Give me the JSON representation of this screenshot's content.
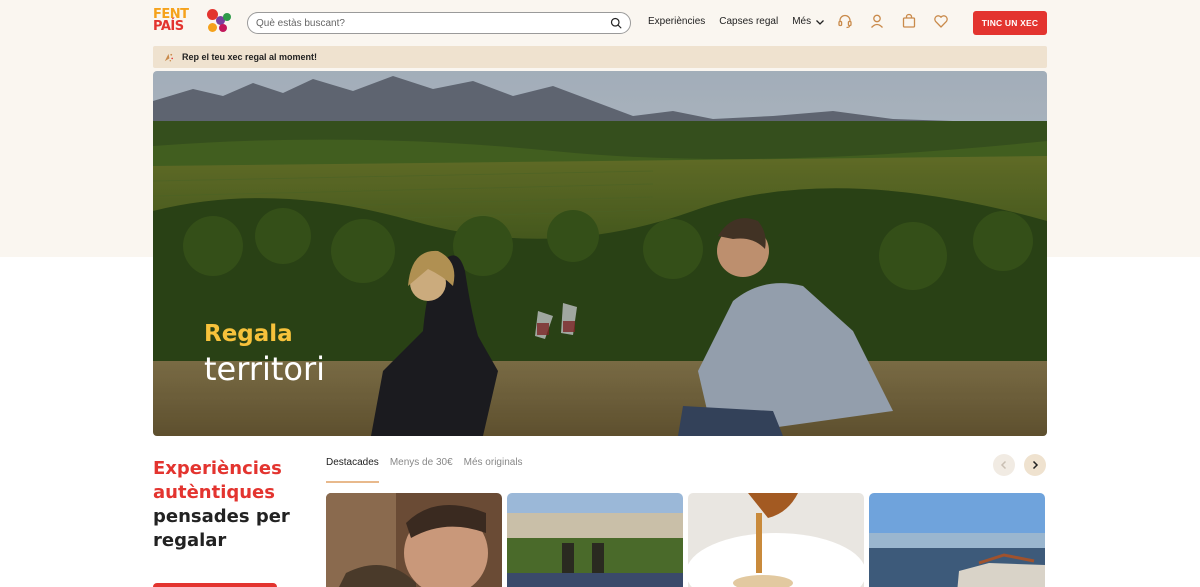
{
  "colors": {
    "accent": "#e3342f",
    "brand_yellow": "#f5a21b",
    "promo_bg": "#efe2cf",
    "page_bg": "#faf6f0"
  },
  "header": {
    "logo_line1": "FENT",
    "logo_line2": "PAÍS",
    "search_placeholder": "Què estàs buscant?",
    "nav": [
      {
        "label": "Experiències"
      },
      {
        "label": "Capses regal"
      },
      {
        "label": "Més",
        "icon": "chevron-down-icon"
      }
    ],
    "icons": [
      "headset-icon",
      "user-icon",
      "bag-icon",
      "heart-icon"
    ],
    "cta_label": "TINC UN XEC"
  },
  "promo": {
    "icon": "gift-icon",
    "text": "Rep el teu xec regal al moment!"
  },
  "hero": {
    "title_line1": "Regala",
    "title_line2": "territori"
  },
  "section": {
    "tagline_line1": "Experiències",
    "tagline_line2": "autèntiques",
    "tagline_line3": "pensades per",
    "tagline_line4": "regalar",
    "tabs": [
      {
        "label": "Destacades",
        "active": true
      },
      {
        "label": "Menys de 30€",
        "active": false
      },
      {
        "label": "Més originals",
        "active": false
      }
    ]
  }
}
